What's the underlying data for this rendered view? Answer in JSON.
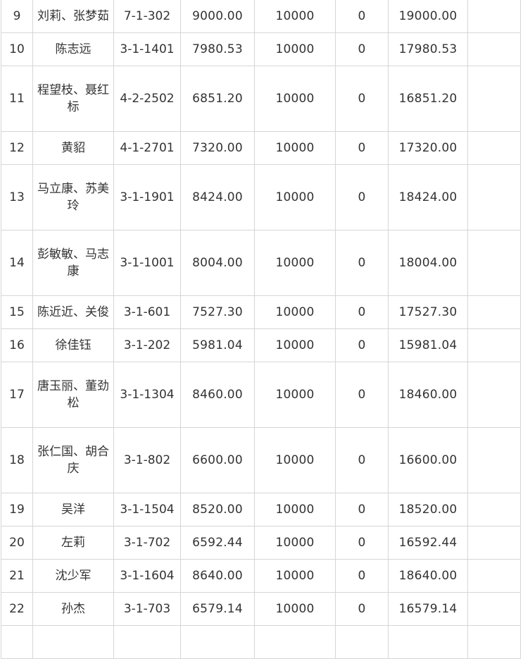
{
  "table": {
    "rows": [
      [
        "9",
        "刘莉、张梦茹",
        "7-1-302",
        "9000.00",
        "10000",
        "0",
        "19000.00",
        ""
      ],
      [
        "10",
        "陈志远",
        "3-1-1401",
        "7980.53",
        "10000",
        "0",
        "17980.53",
        ""
      ],
      [
        "11",
        "程望枝、聂红标",
        "4-2-2502",
        "6851.20",
        "10000",
        "0",
        "16851.20",
        ""
      ],
      [
        "12",
        "黄貂",
        "4-1-2701",
        "7320.00",
        "10000",
        "0",
        "17320.00",
        ""
      ],
      [
        "13",
        "马立康、苏美玲",
        "3-1-1901",
        "8424.00",
        "10000",
        "0",
        "18424.00",
        ""
      ],
      [
        "14",
        "彭敏敏、马志康",
        "3-1-1001",
        "8004.00",
        "10000",
        "0",
        "18004.00",
        ""
      ],
      [
        "15",
        "陈近近、关俊",
        "3-1-601",
        "7527.30",
        "10000",
        "0",
        "17527.30",
        ""
      ],
      [
        "16",
        "徐佳钰",
        "3-1-202",
        "5981.04",
        "10000",
        "0",
        "15981.04",
        ""
      ],
      [
        "17",
        "唐玉丽、董劲松",
        "3-1-1304",
        "8460.00",
        "10000",
        "0",
        "18460.00",
        ""
      ],
      [
        "18",
        "张仁国、胡合庆",
        "3-1-802",
        "6600.00",
        "10000",
        "0",
        "16600.00",
        ""
      ],
      [
        "19",
        "吴洋",
        "3-1-1504",
        "8520.00",
        "10000",
        "0",
        "18520.00",
        ""
      ],
      [
        "20",
        "左莉",
        "3-1-702",
        "6592.44",
        "10000",
        "0",
        "16592.44",
        ""
      ],
      [
        "21",
        "沈少军",
        "3-1-1604",
        "8640.00",
        "10000",
        "0",
        "18640.00",
        ""
      ],
      [
        "22",
        "孙杰",
        "3-1-703",
        "6579.14",
        "10000",
        "0",
        "16579.14",
        ""
      ],
      [
        "",
        "",
        "",
        "",
        "",
        "",
        "",
        ""
      ]
    ]
  }
}
